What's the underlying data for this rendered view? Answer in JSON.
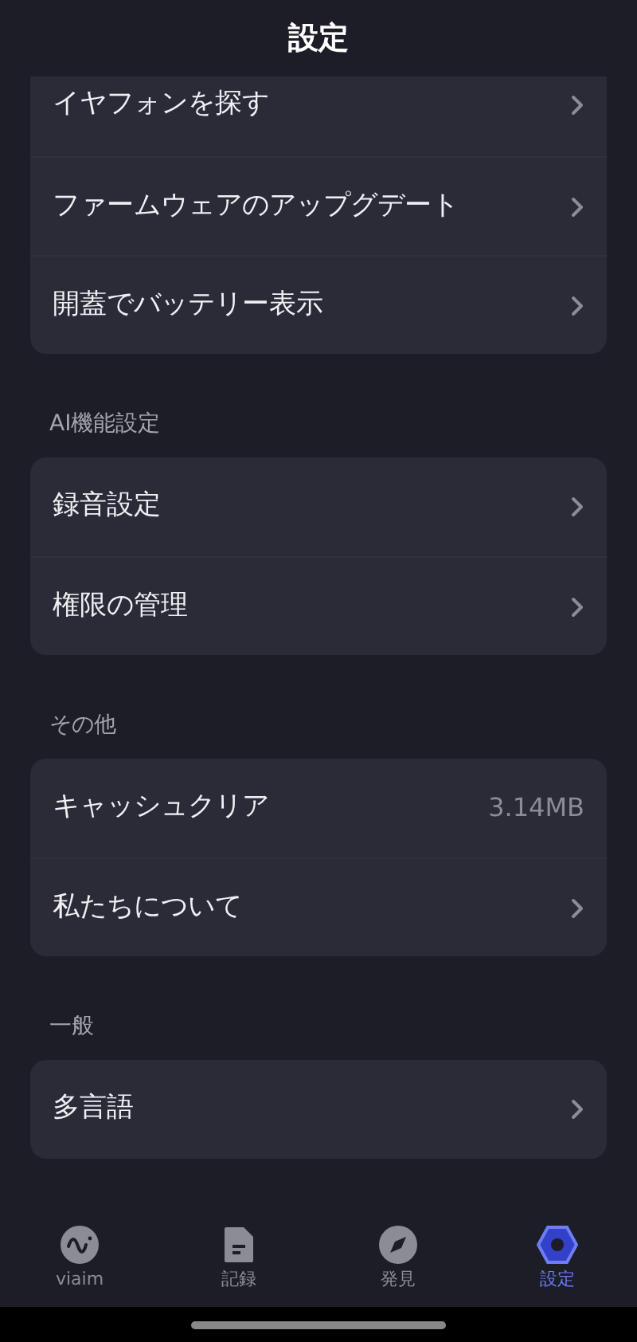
{
  "header": {
    "title": "設定"
  },
  "sections": [
    {
      "items": [
        {
          "kind": "link",
          "label": "イヤフォンを探す"
        },
        {
          "kind": "link",
          "label": "ファームウェアのアップグデート"
        },
        {
          "kind": "link",
          "label": "開蓋でバッテリー表示"
        }
      ]
    },
    {
      "title": "AI機能設定",
      "items": [
        {
          "kind": "link",
          "label": "録音設定"
        },
        {
          "kind": "link",
          "label": "権限の管理"
        }
      ]
    },
    {
      "title": "その他",
      "items": [
        {
          "kind": "value",
          "label": "キャッシュクリア",
          "value": "3.14MB"
        },
        {
          "kind": "link",
          "label": "私たちについて"
        }
      ]
    },
    {
      "title": "一般",
      "items": [
        {
          "kind": "link",
          "label": "多言語"
        }
      ]
    }
  ],
  "tabs": [
    {
      "kind": "wave",
      "label": "viaim",
      "selected": false
    },
    {
      "kind": "doc",
      "label": "記録",
      "selected": false
    },
    {
      "kind": "compass",
      "label": "発見",
      "selected": false
    },
    {
      "kind": "hex",
      "label": "設定",
      "selected": true
    }
  ]
}
